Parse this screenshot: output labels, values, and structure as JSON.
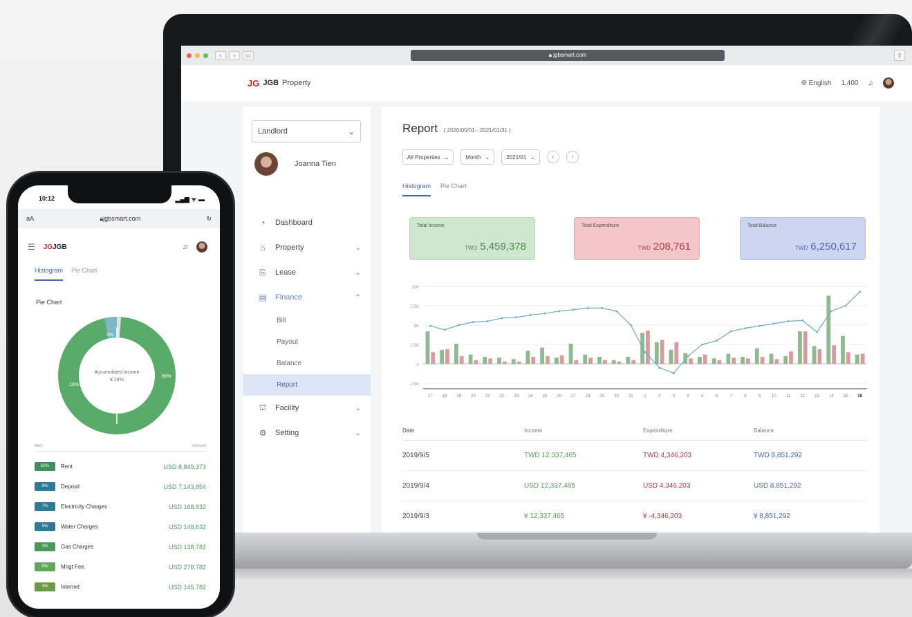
{
  "browser": {
    "url": "jgbsmart.com"
  },
  "header": {
    "logo_mark": "JG",
    "logo_brand": "JGB",
    "logo_suffix": "Property",
    "language": "English",
    "points": "1,400"
  },
  "sidebar": {
    "role": "Landlord",
    "user_name": "Joanna Tien",
    "menu": [
      {
        "label": "Dashboard",
        "icon": "dashboard-icon"
      },
      {
        "label": "Property",
        "icon": "building-icon"
      },
      {
        "label": "Lease",
        "icon": "lease-icon"
      },
      {
        "label": "Finance",
        "icon": "finance-icon"
      }
    ],
    "finance_sub": [
      "Bill",
      "Payout",
      "Balance",
      "Report"
    ],
    "menu_bottom": [
      {
        "label": "Facility",
        "icon": "facility-icon"
      },
      {
        "label": "Setting",
        "icon": "gear-icon"
      }
    ]
  },
  "report": {
    "title": "Report",
    "date_range": "( 2020/05/01 - 2021/01/31 )",
    "filters": {
      "property": "All Properties",
      "period": "Month",
      "month": "2021/01"
    },
    "tabs": [
      "Histogram",
      "Pie Chart"
    ],
    "cards": {
      "income": {
        "label": "Total Income",
        "currency": "TWD",
        "value": "5,459,378"
      },
      "expenditure": {
        "label": "Total Expenditure",
        "currency": "TWD",
        "value": "208,761"
      },
      "balance": {
        "label": "Total Balance",
        "currency": "TWD",
        "value": "6,250,617"
      }
    },
    "table": {
      "headers": [
        "Date",
        "Income",
        "Expenditure",
        "Balance"
      ],
      "rows": [
        [
          "2019/9/5",
          "TWD 12,337,465",
          "TWD 4,346,203",
          "TWD 8,851,292"
        ],
        [
          "2019/9/4",
          "USD 12,337,465",
          "USD 4,346,203",
          "USD 8,851,292"
        ],
        [
          "2019/9/3",
          "¥ 12,337,465",
          "¥ -4,346,203",
          "¥ 8,851,292"
        ]
      ]
    }
  },
  "chart_data": {
    "type": "bar",
    "categories": [
      "17",
      "18",
      "19",
      "20",
      "21",
      "22",
      "23",
      "24",
      "25",
      "26",
      "27",
      "28",
      "29",
      "30",
      "31",
      "1",
      "2",
      "3",
      "4",
      "5",
      "6",
      "7",
      "8",
      "9",
      "10",
      "11",
      "12",
      "13",
      "14",
      "15",
      "16"
    ],
    "y_tick_labels": [
      "10K",
      "7.5K",
      "5K",
      "2.5K",
      "0",
      "-2.5K"
    ],
    "ylim": [
      -2500,
      10000
    ],
    "grid": true,
    "series": [
      {
        "name": "Income",
        "values": [
          4200,
          1800,
          2600,
          1200,
          900,
          800,
          600,
          1700,
          2100,
          800,
          2600,
          1200,
          900,
          500,
          900,
          4000,
          2800,
          1800,
          1400,
          900,
          700,
          1300,
          900,
          2000,
          1300,
          1000,
          4200,
          2300,
          8800,
          3600,
          1200
        ]
      },
      {
        "name": "Expenditure",
        "values": [
          1500,
          1900,
          1000,
          500,
          700,
          300,
          300,
          900,
          1000,
          1100,
          500,
          800,
          500,
          300,
          500,
          4300,
          3100,
          2800,
          700,
          1200,
          500,
          800,
          700,
          900,
          600,
          1600,
          4200,
          1900,
          2400,
          1500,
          1300
        ]
      },
      {
        "name": "Balance",
        "values": [
          4900,
          4400,
          5000,
          5400,
          5500,
          5900,
          6000,
          6300,
          6500,
          6800,
          7000,
          7200,
          7200,
          6800,
          5000,
          1500,
          -500,
          -1200,
          1000,
          2500,
          3000,
          4200,
          4600,
          4900,
          5200,
          5500,
          5600,
          4100,
          6800,
          7500,
          9300
        ]
      }
    ]
  },
  "phone": {
    "time": "10:12",
    "status": "▂▄▆ ᯤ ▬",
    "aA": "aA",
    "url": "jgbsmart.com",
    "logo": "JGB",
    "tabs": [
      "Histogram",
      "Pie Chart"
    ],
    "section_title": "Pie Chart",
    "donut_center": "Accumulated income",
    "donut_center_sub": "¥ 24%",
    "donut_labels": [
      "86%",
      "10%",
      "3%"
    ],
    "legend_head": [
      "Item",
      "Amount"
    ],
    "legend": [
      {
        "pct": "62%",
        "label": "Rent",
        "amount": "USD 8,849,373"
      },
      {
        "pct": "9%",
        "label": "Deposit",
        "amount": "USD 7,143,854"
      },
      {
        "pct": "7%",
        "label": "Electricity Charges",
        "amount": "USD 168,832"
      },
      {
        "pct": "5%",
        "label": "Water Charges",
        "amount": "USD 148,632"
      },
      {
        "pct": "3%",
        "label": "Gas Charges",
        "amount": "USD 138,782"
      },
      {
        "pct": "8%",
        "label": "Mngt Fee",
        "amount": "USD 278,782"
      },
      {
        "pct": "3%",
        "label": "Internet",
        "amount": "USD 145,782"
      }
    ]
  },
  "colors": {
    "income": "#8fb98f",
    "expenditure": "#d79ba0",
    "balance_line": "#6fa8c6",
    "accent": "#4a66b0"
  }
}
